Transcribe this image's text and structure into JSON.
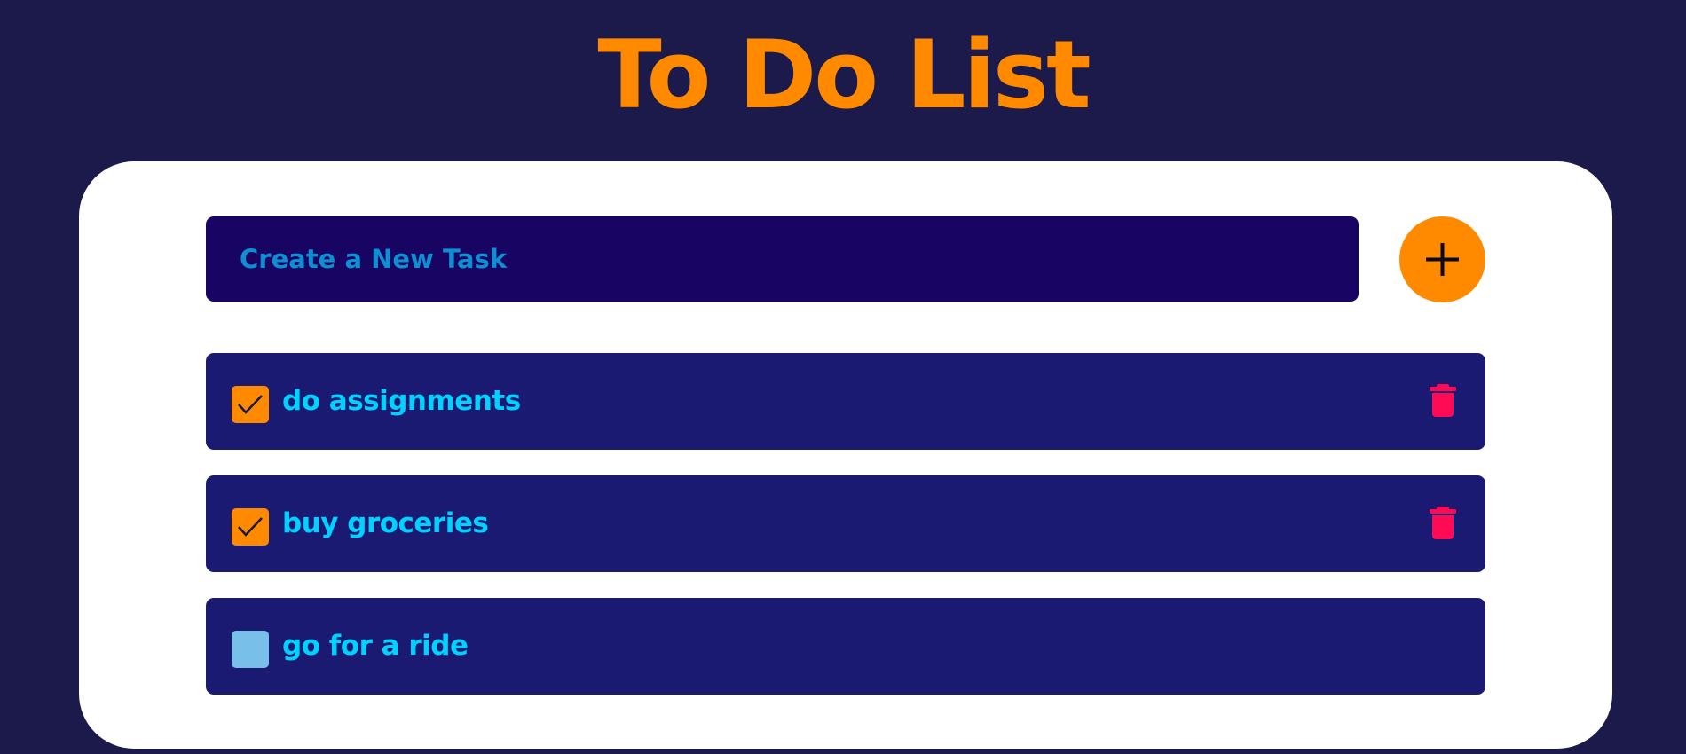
{
  "app": {
    "title": "To Do List"
  },
  "new_task": {
    "placeholder": "Create a New Task",
    "value": "",
    "add_button_icon": "plus-icon"
  },
  "tasks": [
    {
      "label": "do assignments",
      "checked": true,
      "delete_icon": "trash-icon"
    },
    {
      "label": "buy groceries",
      "checked": true,
      "delete_icon": "trash-icon"
    },
    {
      "label": "go for a ride",
      "checked": false
    }
  ],
  "colors": {
    "background": "#1c1a4a",
    "accent": "#ff8a00",
    "input_bg": "#180462",
    "placeholder": "#0d8fd1",
    "task_bg": "#1b1a72",
    "task_text": "#00d2ff",
    "unchecked_box": "#78bfe9",
    "delete": "#ff0a54"
  }
}
